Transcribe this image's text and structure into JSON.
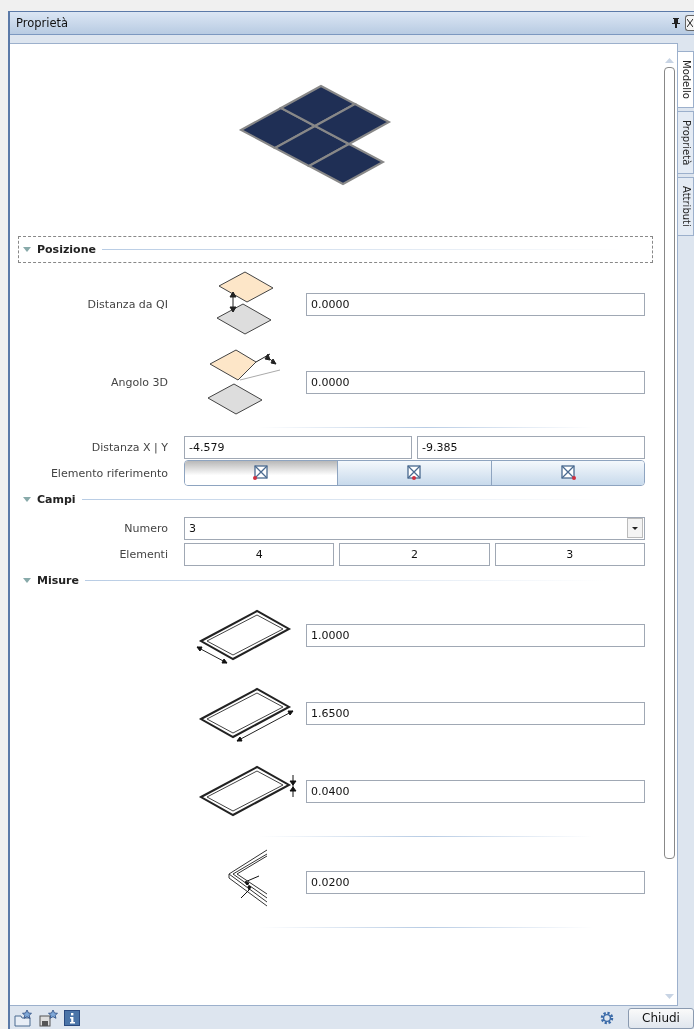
{
  "window": {
    "title": "Proprietà"
  },
  "side_tabs": [
    {
      "label": "Modello",
      "selected": true
    },
    {
      "label": "Proprietà",
      "selected": false
    },
    {
      "label": "Attributi",
      "selected": false
    }
  ],
  "sections": [
    {
      "title": "Posizione",
      "expanded": true,
      "focused": true,
      "rows": [
        {
          "kind": "figure",
          "label": "Distanza da QI",
          "value": "0.0000"
        },
        {
          "kind": "figure",
          "label": "Angolo 3D",
          "value": "0.0000"
        },
        {
          "kind": "divider"
        },
        {
          "kind": "pair",
          "label": "Distanza X | Y",
          "values": [
            "-4.579",
            "-9.385"
          ]
        },
        {
          "kind": "segmented",
          "label": "Elemento riferimento",
          "options": [
            {
              "selected": true
            },
            {
              "selected": false
            },
            {
              "selected": false
            }
          ]
        }
      ]
    },
    {
      "title": "Campi",
      "expanded": true,
      "focused": false,
      "rows": [
        {
          "kind": "dropdown",
          "label": "Numero",
          "value": "3"
        },
        {
          "kind": "buttons",
          "label": "Elementi",
          "values": [
            "4",
            "2",
            "3"
          ]
        }
      ]
    },
    {
      "title": "Misure",
      "expanded": true,
      "focused": false,
      "rows": [
        {
          "kind": "figure",
          "value": "1.0000"
        },
        {
          "kind": "figure",
          "value": "1.6500"
        },
        {
          "kind": "figure",
          "value": "0.0400"
        },
        {
          "kind": "divider"
        },
        {
          "kind": "figure",
          "value": "0.0200"
        },
        {
          "kind": "divider"
        }
      ]
    }
  ],
  "footer": {
    "close_button": "Chiudi"
  }
}
